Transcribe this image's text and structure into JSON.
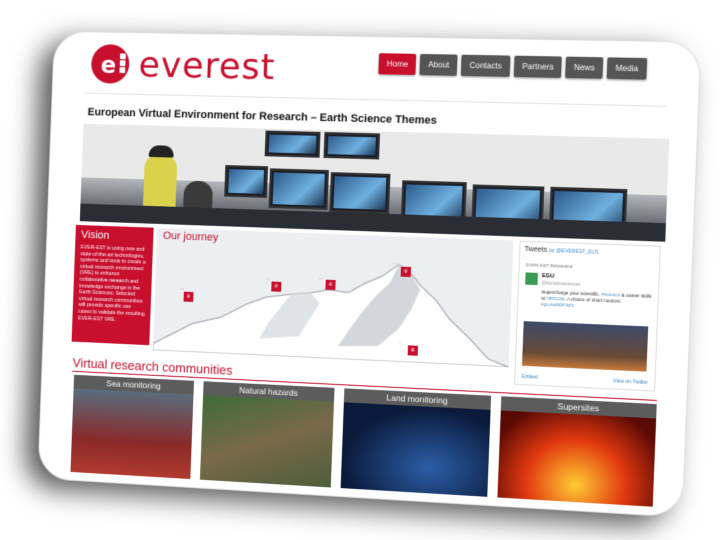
{
  "header": {
    "brand": "everest",
    "logo_letter": "e",
    "nav": [
      "Home",
      "About",
      "Contacts",
      "Partners",
      "News",
      "Media"
    ],
    "active_nav": "Home",
    "tagline": "European Virtual Environment for Research – Earth Science Themes"
  },
  "vision": {
    "title": "Vision",
    "text": "EVER-EST is using new and state-of-the-art technologies, systems and tools to create a virtual research environment (VRE) to enhance collaborative research and knowledge exchange in the Earth Sciences. Selected virtual research communities will provide specific use cases to validate the resulting EVER-EST VRE."
  },
  "journey": {
    "title": "Our journey"
  },
  "tweets": {
    "title": "Tweets",
    "by": "by @EVEREST_EU1",
    "retweeted": "EVER-EST Retweeted",
    "account": "EGU",
    "handle": "@EuroGeosciences",
    "text_pre": "Supercharge your scientific, ",
    "link1": "#science",
    "text_mid": " & career skills at ",
    "link2": "#EGU16",
    "text_post": ". A choice of short courses: ",
    "link3": "egu.eu/6DF3Z1",
    "embed": "Embed",
    "view_on": "View on Twitter"
  },
  "communities": {
    "title": "Virtual research communities",
    "cards": [
      "Sea monitoring",
      "Natural hazards",
      "Land monitoring",
      "Supersites"
    ]
  },
  "colors": {
    "brand_red": "#c8102e",
    "nav_gray": "#555555"
  }
}
